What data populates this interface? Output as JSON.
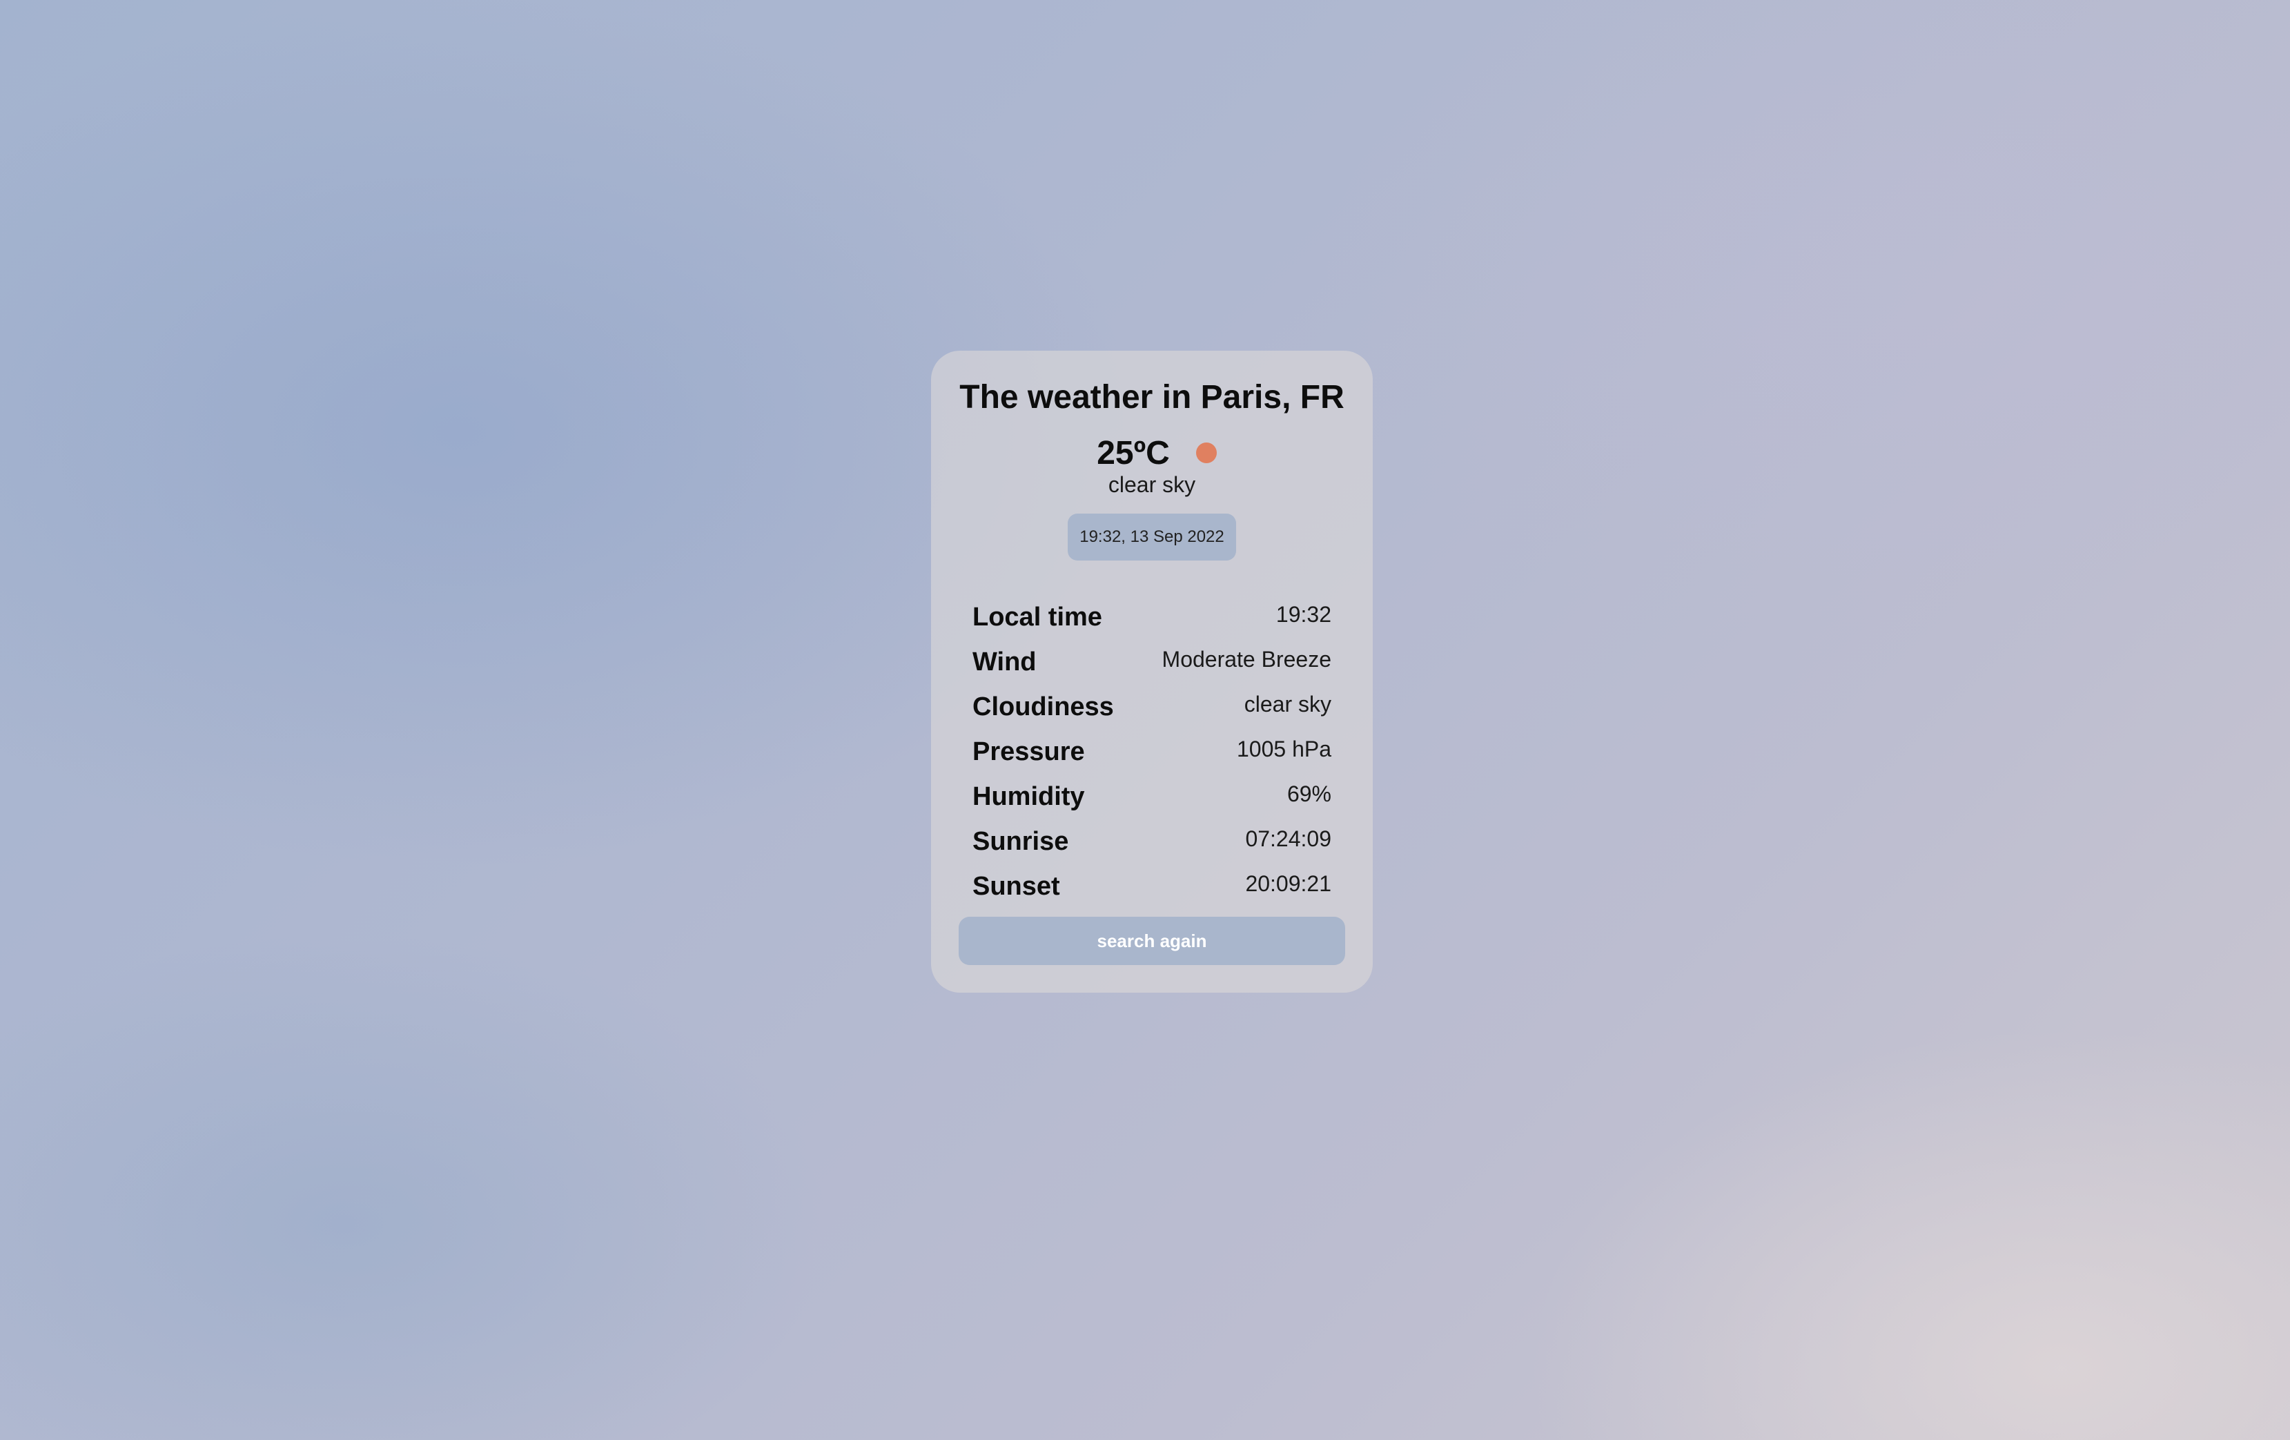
{
  "card": {
    "title": "The weather in Paris, FR",
    "temperature": "25ºC",
    "weather_icon": "sun-icon",
    "description": "clear sky",
    "datetime": "19:32, 13 Sep 2022"
  },
  "details": [
    {
      "label": "Local time",
      "value": "19:32"
    },
    {
      "label": "Wind",
      "value": "Moderate Breeze"
    },
    {
      "label": "Cloudiness",
      "value": "clear sky"
    },
    {
      "label": "Pressure",
      "value": "1005 hPa"
    },
    {
      "label": "Humidity",
      "value": "69%"
    },
    {
      "label": "Sunrise",
      "value": "07:24:09"
    },
    {
      "label": "Sunset",
      "value": "20:09:21"
    }
  ],
  "actions": {
    "search_again_label": "search again"
  },
  "colors": {
    "accent": "#a9b6cc",
    "sun": "#e08060",
    "card": "#dcd8d8"
  }
}
